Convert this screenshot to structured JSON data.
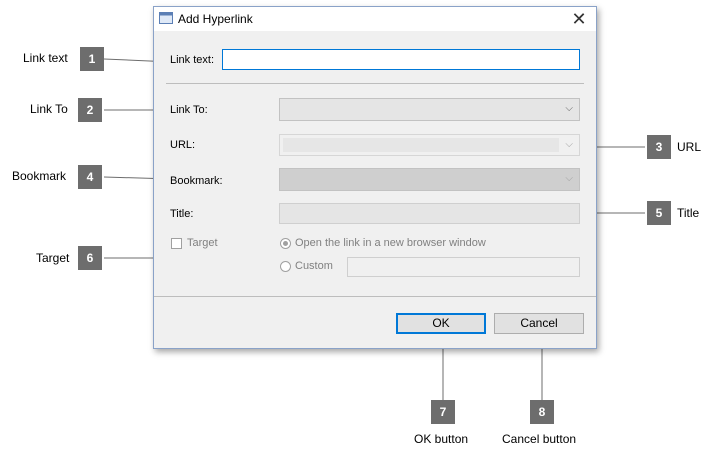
{
  "dialog": {
    "title": "Add Hyperlink",
    "close_glyph": "✕",
    "app_icon": "window-icon",
    "link_text_label": "Link text:",
    "link_text_value": "",
    "link_to_label": "Link To:",
    "link_to_value": "",
    "url_label": "URL:",
    "url_value": "",
    "bookmark_label": "Bookmark:",
    "bookmark_value": "",
    "title_label": "Title:",
    "title_value": "",
    "target_label": "Target",
    "target_checked": false,
    "radio_new_window_label": "Open the link in a new browser window",
    "radio_custom_label": "Custom",
    "custom_value": "",
    "ok_label": "OK",
    "cancel_label": "Cancel",
    "chevron_glyph": "⌵"
  },
  "callouts": [
    {
      "number": "1",
      "text": "Link text"
    },
    {
      "number": "2",
      "text": "Link To"
    },
    {
      "number": "3",
      "text": "URL"
    },
    {
      "number": "4",
      "text": "Bookmark"
    },
    {
      "number": "5",
      "text": "Title"
    },
    {
      "number": "6",
      "text": "Target"
    },
    {
      "number": "7",
      "text": "OK button"
    },
    {
      "number": "8",
      "text": "Cancel button"
    }
  ],
  "colors": {
    "accent": "#0078d7",
    "badge": "#6d6d6d"
  }
}
